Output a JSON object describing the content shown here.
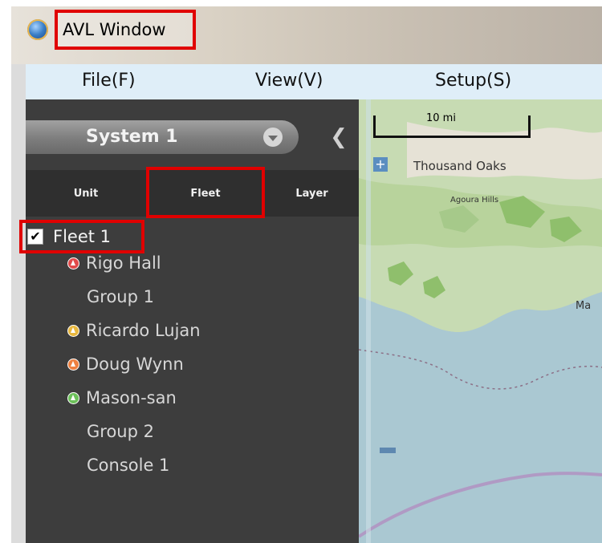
{
  "window": {
    "title": "AVL Window"
  },
  "menu": {
    "file": "File(F)",
    "view": "View(V)",
    "setup": "Setup(S)"
  },
  "panel": {
    "system": "System 1",
    "tabs": [
      {
        "label": "Unit"
      },
      {
        "label": "Fleet"
      },
      {
        "label": "Layer"
      }
    ],
    "active_tab": "Fleet",
    "collapse_glyph": "❮"
  },
  "tree": {
    "fleet": {
      "label": "Fleet 1",
      "checked": true,
      "check_glyph": "✔"
    },
    "items": [
      {
        "label": "Rigo Hall",
        "icon": "unit-icon",
        "color": "#e14a4a"
      },
      {
        "label": "Group 1"
      },
      {
        "label": "Ricardo Lujan",
        "icon": "unit-icon",
        "color": "#e8b840"
      },
      {
        "label": "Doug Wynn",
        "icon": "unit-icon",
        "color": "#ee8040"
      },
      {
        "label": "Mason-san",
        "icon": "unit-icon",
        "color": "#6cc15a"
      },
      {
        "label": "Group 2"
      },
      {
        "label": "Console 1"
      }
    ]
  },
  "map": {
    "scale": "10 mi",
    "zoom_in_glyph": "+",
    "labels": {
      "thousand_oaks": "Thousand Oaks",
      "agoura_hills": "Agoura Hills",
      "malibu_partial": "Ma"
    }
  }
}
